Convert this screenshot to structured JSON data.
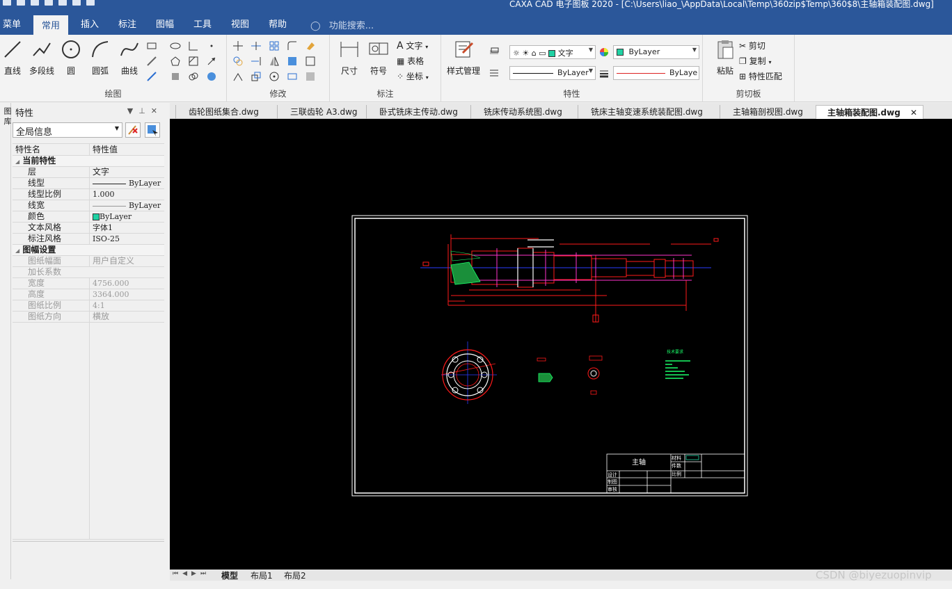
{
  "window": {
    "title": "CAXA CAD 电子图板 2020 - [C:\\Users\\liao_\\AppData\\Local\\Temp\\360zip$Temp\\360$8\\主轴箱装配图.dwg]"
  },
  "ribbon_tabs": [
    "菜单",
    "常用",
    "插入",
    "标注",
    "图幅",
    "工具",
    "视图",
    "帮助"
  ],
  "active_ribbon_tab": "常用",
  "search_placeholder": "功能搜索...",
  "groups": {
    "draw": {
      "label": "绘图",
      "buttons": [
        "直线",
        "多段线",
        "圆",
        "圆弧",
        "曲线"
      ]
    },
    "modify": {
      "label": "修改"
    },
    "dimension": {
      "label": "标注",
      "buttons": [
        "尺寸",
        "符号"
      ],
      "small": [
        "文字",
        "表格",
        "坐标"
      ]
    },
    "properties": {
      "label": "特性",
      "style_manager": "样式管理",
      "text_style_combo": "文字",
      "color_combo": "ByLayer",
      "linetype_combo": "ByLayer",
      "lineweight_combo": "ByLaye"
    },
    "clipboard": {
      "label": "剪切板",
      "paste": "粘贴",
      "items": [
        "剪切",
        "复制",
        "特性匹配"
      ]
    }
  },
  "properties_panel": {
    "title": "特性",
    "vertical_tab": "图 库",
    "scope_select": "全局信息",
    "header_name": "特性名",
    "header_value": "特性值",
    "sections": [
      {
        "title": "当前特性",
        "rows": [
          {
            "k": "层",
            "v": "文字"
          },
          {
            "k": "线型",
            "v": "ByLayer"
          },
          {
            "k": "线型比例",
            "v": "1.000"
          },
          {
            "k": "线宽",
            "v": "ByLayer"
          },
          {
            "k": "颜色",
            "v": "ByLayer"
          },
          {
            "k": "文本风格",
            "v": "字体1"
          },
          {
            "k": "标注风格",
            "v": "ISO-25"
          }
        ]
      },
      {
        "title": "图幅设置",
        "rows": [
          {
            "k": "图纸幅面",
            "v": "用户自定义"
          },
          {
            "k": "加长系数",
            "v": ""
          },
          {
            "k": "宽度",
            "v": "4756.000"
          },
          {
            "k": "高度",
            "v": "3364.000"
          },
          {
            "k": "图纸比例",
            "v": "4:1"
          },
          {
            "k": "图纸方向",
            "v": "横放"
          }
        ]
      }
    ]
  },
  "doc_tabs": [
    "齿轮图纸集合.dwg",
    "三联齿轮 A3.dwg",
    "卧式铣床主传动.dwg",
    "铣床传动系统图.dwg",
    "铣床主轴变速系统装配图.dwg",
    "主轴箱剖视图.dwg",
    "主轴箱装配图.dwg"
  ],
  "active_doc_tab": "主轴箱装配图.dwg",
  "drawing": {
    "title_block_name": "主轴",
    "tb_labels": [
      "材料",
      "件数",
      "比例",
      "设计",
      "制图",
      "审核"
    ],
    "tech_req": "技术要求"
  },
  "layout_tabs": [
    "模型",
    "布局1",
    "布局2"
  ],
  "active_layout_tab": "模型",
  "watermark": "CSDN @biyezuopinvip",
  "colors": {
    "ribbon_blue": "#2b579a",
    "canvas": "#000000",
    "cad_red": "#ff1a1a",
    "cad_white": "#ffffff",
    "cad_blue": "#2a3bff",
    "cad_green": "#1aff6a",
    "cad_magenta": "#ff33cc"
  }
}
